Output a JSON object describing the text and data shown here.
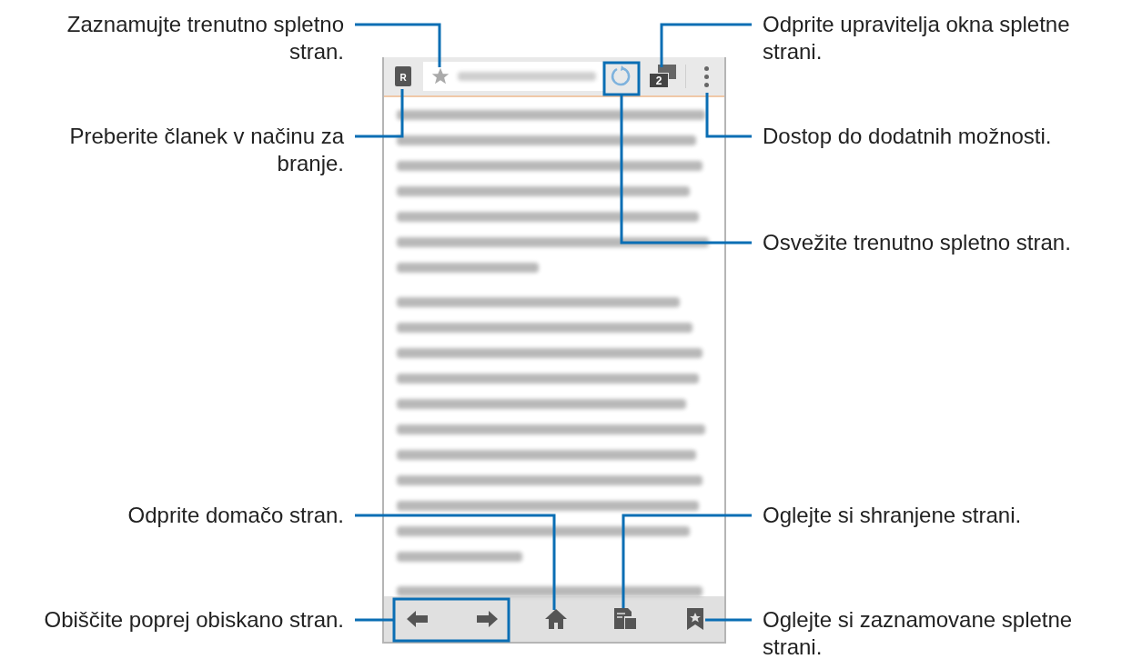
{
  "browser": {
    "reader_badge": "R",
    "tab_count": "2"
  },
  "callouts": [
    {
      "lines": [
        "Zaznamujte trenutno spletno",
        "stran."
      ]
    },
    {
      "lines": [
        "Preberite članek v načinu za",
        "branje."
      ]
    },
    {
      "lines": [
        "Odprite upravitelja okna spletne",
        "strani."
      ]
    },
    {
      "lines": [
        "Dostop do dodatnih možnosti."
      ]
    },
    {
      "lines": [
        "Osvežite trenutno spletno stran."
      ]
    },
    {
      "lines": [
        "Odprite domačo stran."
      ]
    },
    {
      "lines": [
        "Oglejte si shranjene strani."
      ]
    },
    {
      "lines": [
        "Obiščite poprej obiskano stran."
      ]
    },
    {
      "lines": [
        "Oglejte si zaznamovane spletne",
        "strani."
      ]
    }
  ]
}
